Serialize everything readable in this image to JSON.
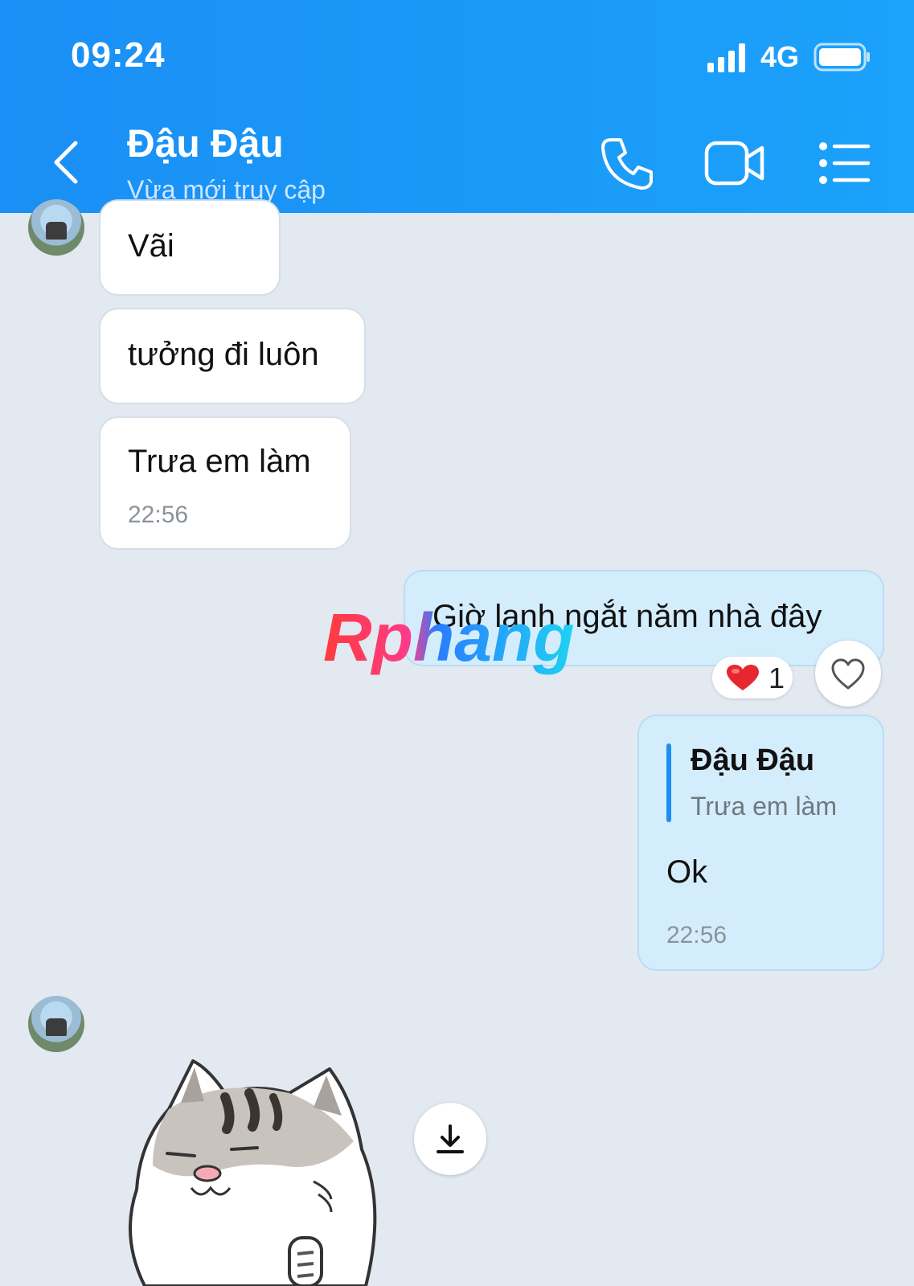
{
  "status_bar": {
    "time": "09:24",
    "network": "4G"
  },
  "header": {
    "name": "Đậu Đậu",
    "status": "Vừa mới truy cập"
  },
  "messages": {
    "m1": {
      "text": "Vãi"
    },
    "m2": {
      "text": "tưởng đi luôn"
    },
    "m3": {
      "text": "Trưa em làm",
      "time": "22:56"
    },
    "m4": {
      "text": "Giờ lạnh ngắt năm nhà đây",
      "reaction_count": "1"
    },
    "m5": {
      "quote_name": "Đậu Đậu",
      "quote_text": "Trưa em làm",
      "text": "Ok",
      "time": "22:56"
    }
  },
  "watermark": "Rphang",
  "icons": [
    "back-icon",
    "phone-icon",
    "video-icon",
    "menu-icon",
    "heart-icon",
    "like-icon",
    "download-icon",
    "cat-sticker"
  ],
  "colors": {
    "header": "#1b9af8",
    "bubble_mine": "#d4edfd",
    "background": "#e2e9f1"
  }
}
